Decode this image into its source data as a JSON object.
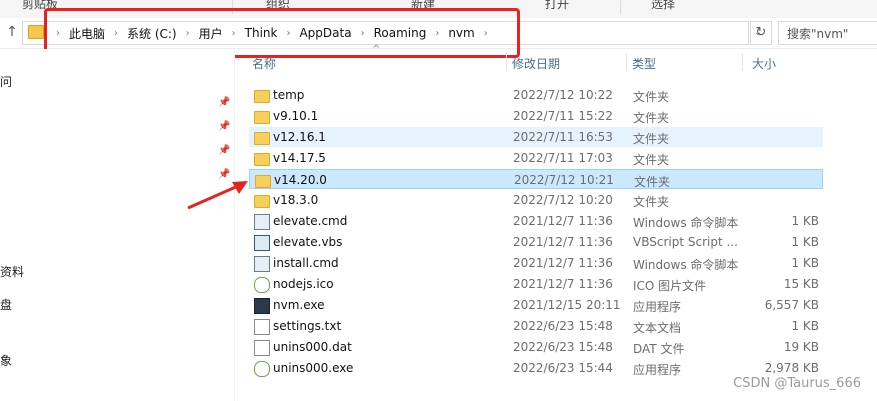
{
  "ribbon": {
    "groups": [
      "剪贴板",
      "组织",
      "新建",
      "打开",
      "选择"
    ]
  },
  "address": {
    "crumbs": [
      "此电脑",
      "系统 (C:)",
      "用户",
      "Think",
      "AppData",
      "Roaming",
      "nvm"
    ],
    "search_placeholder": "搜索\"nvm\""
  },
  "nav": {
    "items": [
      "问",
      "资料",
      "盘",
      "象"
    ]
  },
  "columns": {
    "name": "名称",
    "date": "修改日期",
    "type": "类型",
    "size": "大小"
  },
  "files": [
    {
      "name": "temp",
      "date": "2022/7/12 10:22",
      "type": "文件夹",
      "size": "",
      "icon": "folder-icon"
    },
    {
      "name": "v9.10.1",
      "date": "2022/7/11 15:22",
      "type": "文件夹",
      "size": "",
      "icon": "folder-icon"
    },
    {
      "name": "v12.16.1",
      "date": "2022/7/11 16:53",
      "type": "文件夹",
      "size": "",
      "icon": "folder-icon"
    },
    {
      "name": "v14.17.5",
      "date": "2022/7/11 17:03",
      "type": "文件夹",
      "size": "",
      "icon": "folder-icon"
    },
    {
      "name": "v14.20.0",
      "date": "2022/7/12 10:21",
      "type": "文件夹",
      "size": "",
      "icon": "folder-icon"
    },
    {
      "name": "v18.3.0",
      "date": "2022/7/12 10:20",
      "type": "文件夹",
      "size": "",
      "icon": "folder-icon"
    },
    {
      "name": "elevate.cmd",
      "date": "2021/12/7 11:36",
      "type": "Windows 命令脚本",
      "size": "1 KB",
      "icon": "cmd-file-icon"
    },
    {
      "name": "elevate.vbs",
      "date": "2021/12/7 11:36",
      "type": "VBScript Script ...",
      "size": "1 KB",
      "icon": "vbs-file-icon"
    },
    {
      "name": "install.cmd",
      "date": "2021/12/7 11:36",
      "type": "Windows 命令脚本",
      "size": "1 KB",
      "icon": "cmd-file-icon"
    },
    {
      "name": "nodejs.ico",
      "date": "2021/12/7 11:36",
      "type": "ICO 图片文件",
      "size": "15 KB",
      "icon": "nodejs-icon"
    },
    {
      "name": "nvm.exe",
      "date": "2021/12/15 20:11",
      "type": "应用程序",
      "size": "6,557 KB",
      "icon": "exe-icon"
    },
    {
      "name": "settings.txt",
      "date": "2022/6/23 15:48",
      "type": "文本文档",
      "size": "1 KB",
      "icon": "text-file-icon"
    },
    {
      "name": "unins000.dat",
      "date": "2022/6/23 15:48",
      "type": "DAT 文件",
      "size": "19 KB",
      "icon": "dat-file-icon"
    },
    {
      "name": "unins000.exe",
      "date": "2022/6/23 15:44",
      "type": "应用程序",
      "size": "2,978 KB",
      "icon": "nodejs-icon"
    }
  ],
  "watermark": "CSDN @Taurus_666",
  "colors": {
    "highlight": "#e8231f",
    "selection": "#cce8ff",
    "hover": "#e5f3ff",
    "folder": "#f7cf5b"
  }
}
